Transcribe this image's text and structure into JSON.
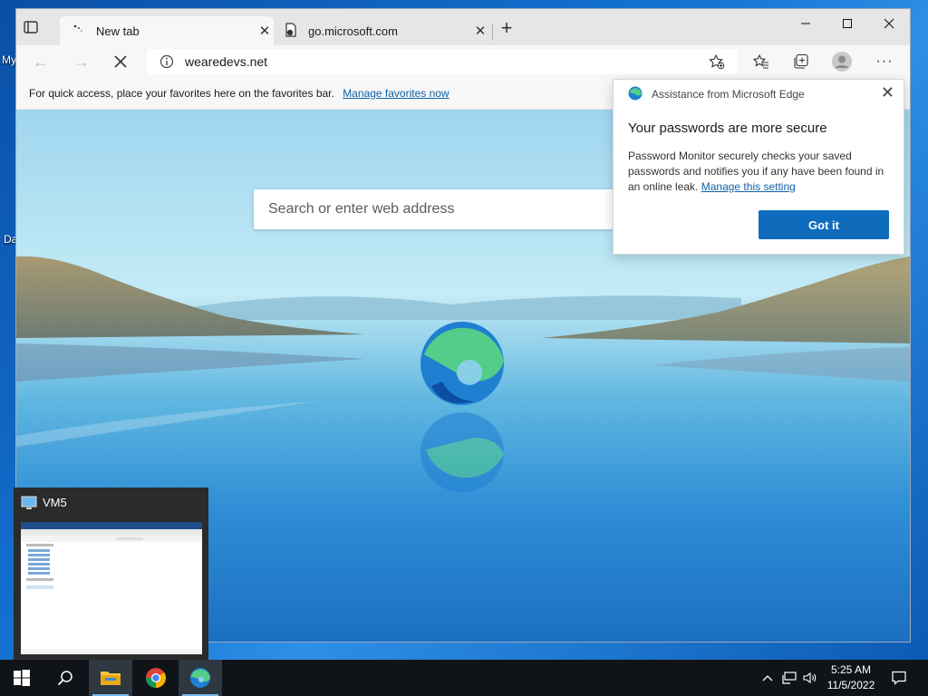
{
  "desktop": {
    "icon_labels": [
      "My",
      "Da"
    ]
  },
  "browser": {
    "tabs": [
      {
        "title": "New tab",
        "active": true
      },
      {
        "title": "go.microsoft.com",
        "active": false
      }
    ],
    "address": "wearedevs.net",
    "favorites_bar": {
      "message": "For quick access, place your favorites here on the favorites bar.",
      "link": "Manage favorites now"
    },
    "search_placeholder": "Search or enter web address"
  },
  "popup": {
    "header": "Assistance from Microsoft Edge",
    "title": "Your passwords are more secure",
    "body": "Password Monitor securely checks your saved passwords and notifies you if any have been found in an online leak.",
    "link": "Manage this setting",
    "button": "Got it"
  },
  "thumbnail": {
    "title": "VM5"
  },
  "taskbar": {
    "time": "5:25 AM",
    "date": "11/5/2022"
  },
  "colors": {
    "accent": "#0f6cbd",
    "link": "#0f62a8",
    "taskbar": "#101418"
  }
}
